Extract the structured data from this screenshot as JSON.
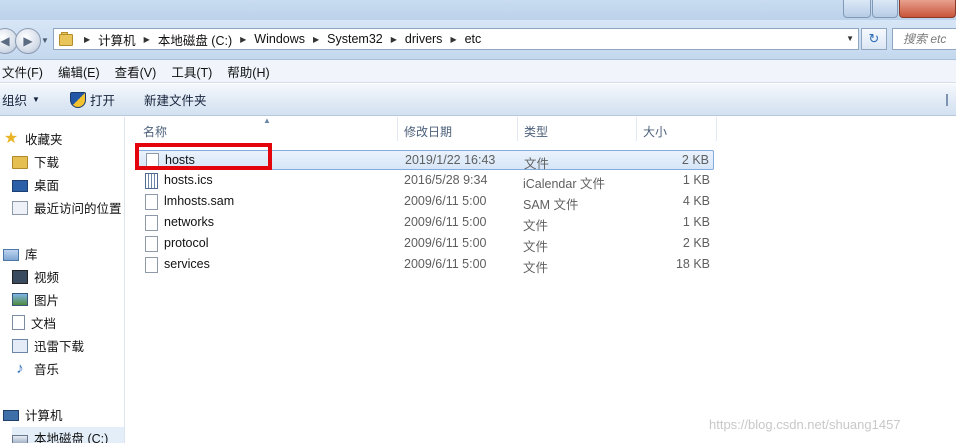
{
  "window": {
    "breadcrumbs": [
      "计算机",
      "本地磁盘 (C:)",
      "Windows",
      "System32",
      "drivers",
      "etc"
    ],
    "search_placeholder": "搜索 etc"
  },
  "menu": [
    "文件(F)",
    "编辑(E)",
    "查看(V)",
    "工具(T)",
    "帮助(H)"
  ],
  "toolbar": {
    "organize": "组织",
    "open": "打开",
    "new_folder": "新建文件夹"
  },
  "nav": {
    "favorites": "收藏夹",
    "downloads": "下载",
    "desktop": "桌面",
    "recent": "最近访问的位置",
    "libraries": "库",
    "videos": "视频",
    "pictures": "图片",
    "documents": "文档",
    "thunder": "迅雷下载",
    "music": "音乐",
    "computer": "计算机",
    "local_disk": "本地磁盘 (C:)"
  },
  "columns": {
    "name": "名称",
    "modified": "修改日期",
    "type": "类型",
    "size": "大小"
  },
  "files": [
    {
      "name": "hosts",
      "modified": "2019/1/22 16:43",
      "type": "文件",
      "size": "2 KB",
      "icon": "file-icon"
    },
    {
      "name": "hosts.ics",
      "modified": "2016/5/28 9:34",
      "type": "iCalendar 文件",
      "size": "1 KB",
      "icon": "calendar-file-icon"
    },
    {
      "name": "lmhosts.sam",
      "modified": "2009/6/11 5:00",
      "type": "SAM 文件",
      "size": "4 KB",
      "icon": "file-icon"
    },
    {
      "name": "networks",
      "modified": "2009/6/11 5:00",
      "type": "文件",
      "size": "1 KB",
      "icon": "file-icon"
    },
    {
      "name": "protocol",
      "modified": "2009/6/11 5:00",
      "type": "文件",
      "size": "2 KB",
      "icon": "file-icon"
    },
    {
      "name": "services",
      "modified": "2009/6/11 5:00",
      "type": "文件",
      "size": "18 KB",
      "icon": "file-icon"
    }
  ],
  "watermark": "https://blog.csdn.net/shuang1457",
  "colors": {
    "highlight": "#e3040c",
    "selection": "#d6e6f8"
  }
}
